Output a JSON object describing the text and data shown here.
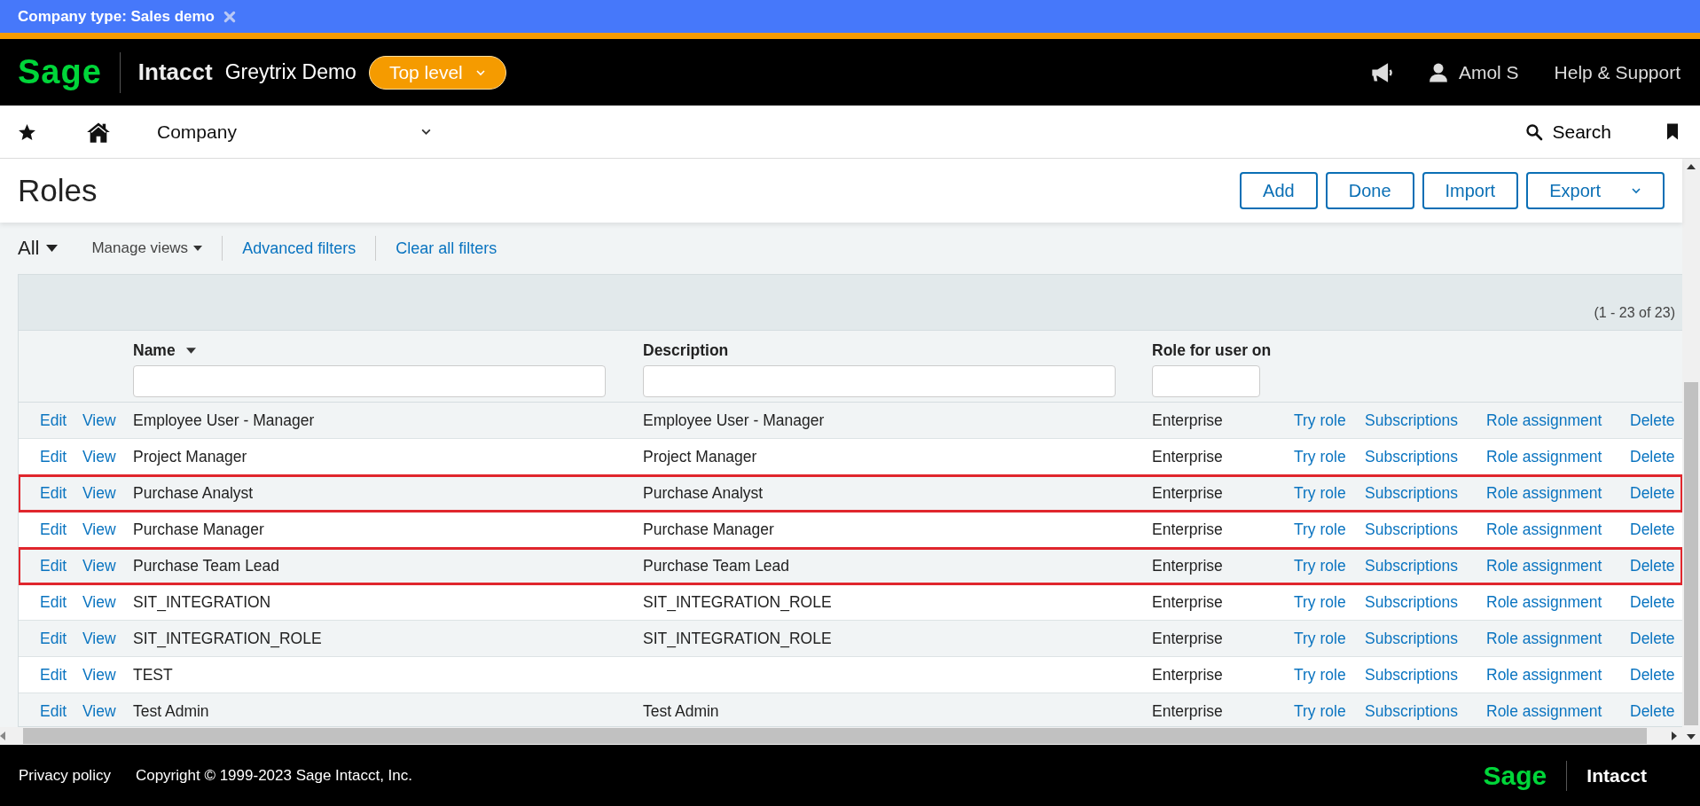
{
  "banner": {
    "text": "Company type: Sales demo"
  },
  "header": {
    "logo": "Sage",
    "product": "Intacct",
    "company": "Greytrix Demo",
    "level_button": "Top level",
    "user": "Amol S",
    "help": "Help & Support"
  },
  "nav": {
    "module": "Company",
    "search": "Search"
  },
  "page": {
    "title": "Roles",
    "buttons": [
      {
        "label": "Add",
        "kind": "plain"
      },
      {
        "label": "Done",
        "kind": "plain"
      },
      {
        "label": "Import",
        "kind": "plain"
      },
      {
        "label": "Export",
        "kind": "dropdown"
      }
    ]
  },
  "filters": {
    "view": "All",
    "manage_views": "Manage views",
    "links": [
      "Advanced filters",
      "Clear all filters"
    ]
  },
  "table": {
    "count": "(1 - 23 of 23)",
    "columns": [
      {
        "label": "Name",
        "sorted": true
      },
      {
        "label": "Description",
        "sorted": false
      },
      {
        "label": "Role for user on",
        "sorted": false
      }
    ],
    "rows": [
      {
        "lead_actions": [
          "Edit",
          "View"
        ],
        "name": "Employee User - Manager",
        "description": "Employee User - Manager",
        "role_for": "Enterprise",
        "actions": [
          "Try role",
          "Subscriptions",
          "Role assignment",
          "Delete"
        ],
        "highlighted": false
      },
      {
        "lead_actions": [
          "Edit",
          "View"
        ],
        "name": "Project Manager",
        "description": "Project Manager",
        "role_for": "Enterprise",
        "actions": [
          "Try role",
          "Subscriptions",
          "Role assignment",
          "Delete"
        ],
        "highlighted": false
      },
      {
        "lead_actions": [
          "Edit",
          "View"
        ],
        "name": "Purchase Analyst",
        "description": "Purchase Analyst",
        "role_for": "Enterprise",
        "actions": [
          "Try role",
          "Subscriptions",
          "Role assignment",
          "Delete"
        ],
        "highlighted": true
      },
      {
        "lead_actions": [
          "Edit",
          "View"
        ],
        "name": "Purchase Manager",
        "description": "Purchase Manager",
        "role_for": "Enterprise",
        "actions": [
          "Try role",
          "Subscriptions",
          "Role assignment",
          "Delete"
        ],
        "highlighted": false
      },
      {
        "lead_actions": [
          "Edit",
          "View"
        ],
        "name": "Purchase Team Lead",
        "description": "Purchase Team Lead",
        "role_for": "Enterprise",
        "actions": [
          "Try role",
          "Subscriptions",
          "Role assignment",
          "Delete"
        ],
        "highlighted": true
      },
      {
        "lead_actions": [
          "Edit",
          "View"
        ],
        "name": "SIT_INTEGRATION",
        "description": "SIT_INTEGRATION_ROLE",
        "role_for": "Enterprise",
        "actions": [
          "Try role",
          "Subscriptions",
          "Role assignment",
          "Delete"
        ],
        "highlighted": false
      },
      {
        "lead_actions": [
          "Edit",
          "View"
        ],
        "name": "SIT_INTEGRATION_ROLE",
        "description": "SIT_INTEGRATION_ROLE",
        "role_for": "Enterprise",
        "actions": [
          "Try role",
          "Subscriptions",
          "Role assignment",
          "Delete"
        ],
        "highlighted": false
      },
      {
        "lead_actions": [
          "Edit",
          "View"
        ],
        "name": "TEST",
        "role_for": "Enterprise",
        "actions": [
          "Try role",
          "Subscriptions",
          "Role assignment",
          "Delete"
        ],
        "highlighted": false
      },
      {
        "lead_actions": [
          "Edit",
          "View"
        ],
        "name": "Test Admin",
        "description": "Test Admin",
        "role_for": "Enterprise",
        "actions": [
          "Try role",
          "Subscriptions",
          "Role assignment",
          "Delete"
        ],
        "highlighted": false
      }
    ]
  },
  "footer": {
    "links": [
      "Privacy policy"
    ],
    "copyright": "Copyright © 1999-2023 Sage Intacct, Inc.",
    "logo": "Sage",
    "product": "Intacct"
  }
}
